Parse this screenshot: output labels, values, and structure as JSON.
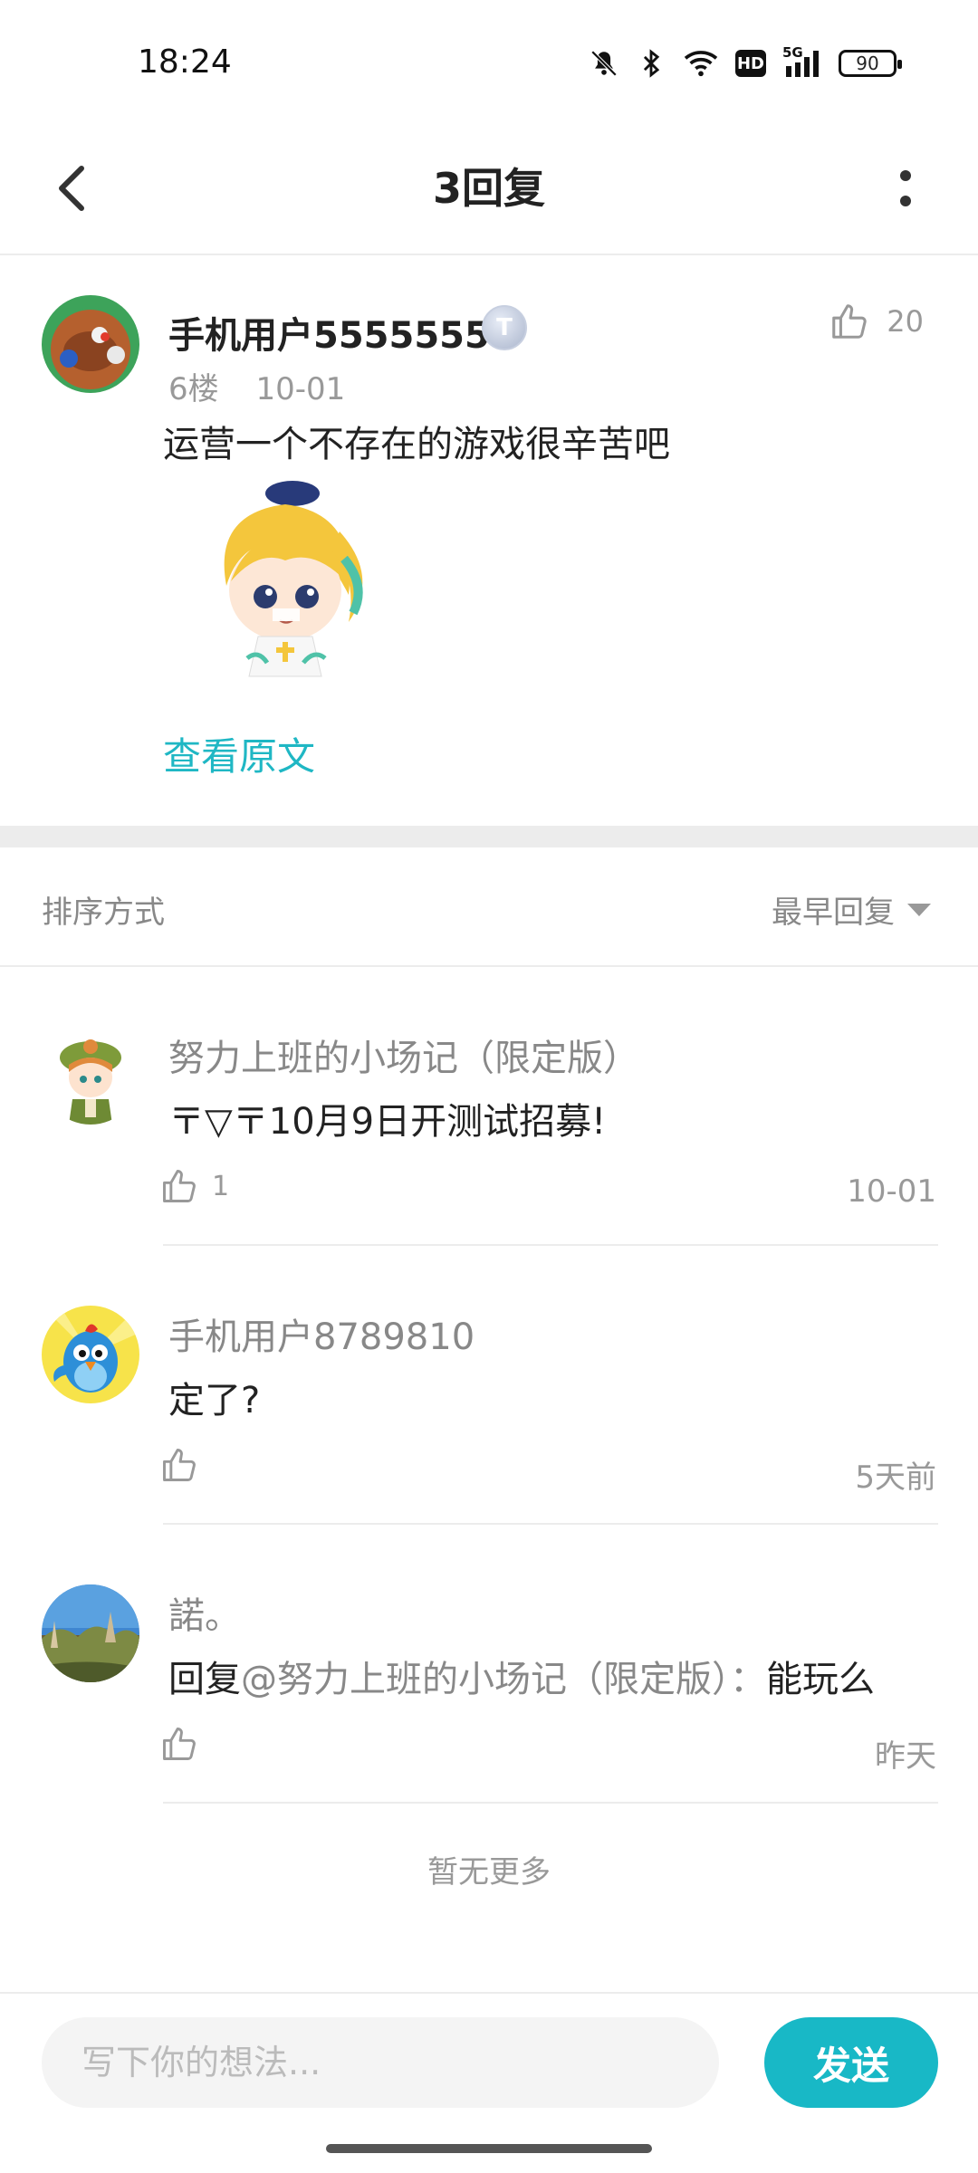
{
  "status_bar": {
    "time": "18:24",
    "icons": [
      "mute-bell-icon",
      "bluetooth-icon",
      "wifi-icon",
      "hd-icon",
      "5g-signal-icon",
      "battery-icon"
    ],
    "hd_label": "HD",
    "network_label": "5G",
    "battery": "90"
  },
  "header": {
    "title": "3回复"
  },
  "post": {
    "username": "手机用户5555555",
    "level_badge": "T",
    "floor": "6楼",
    "date": "10-01",
    "like_count": "20",
    "text": "运营一个不存在的游戏很辛苦吧",
    "view_original": "查看原文"
  },
  "sort": {
    "label": "排序方式",
    "selected": "最早回复"
  },
  "replies": [
    {
      "username": "努力上班的小场记（限定版）",
      "text": "〒▽〒10月9日开测试招募!",
      "like_count": "1",
      "time": "10-01"
    },
    {
      "username": "手机用户8789810",
      "text": "定了?",
      "like_count": "",
      "time": "5天前"
    },
    {
      "username": "諾。",
      "text_prefix": "回复",
      "mention": "@努力上班的小场记（限定版）：",
      "text": "能玩么",
      "like_count": "",
      "time": "昨天"
    }
  ],
  "no_more": "暂无更多",
  "composer": {
    "placeholder": "写下你的想法...",
    "send_label": "发送"
  },
  "colors": {
    "accent": "#18b8c6",
    "link": "#1fb7c4",
    "muted_text": "#999999",
    "divider": "#ececec"
  }
}
